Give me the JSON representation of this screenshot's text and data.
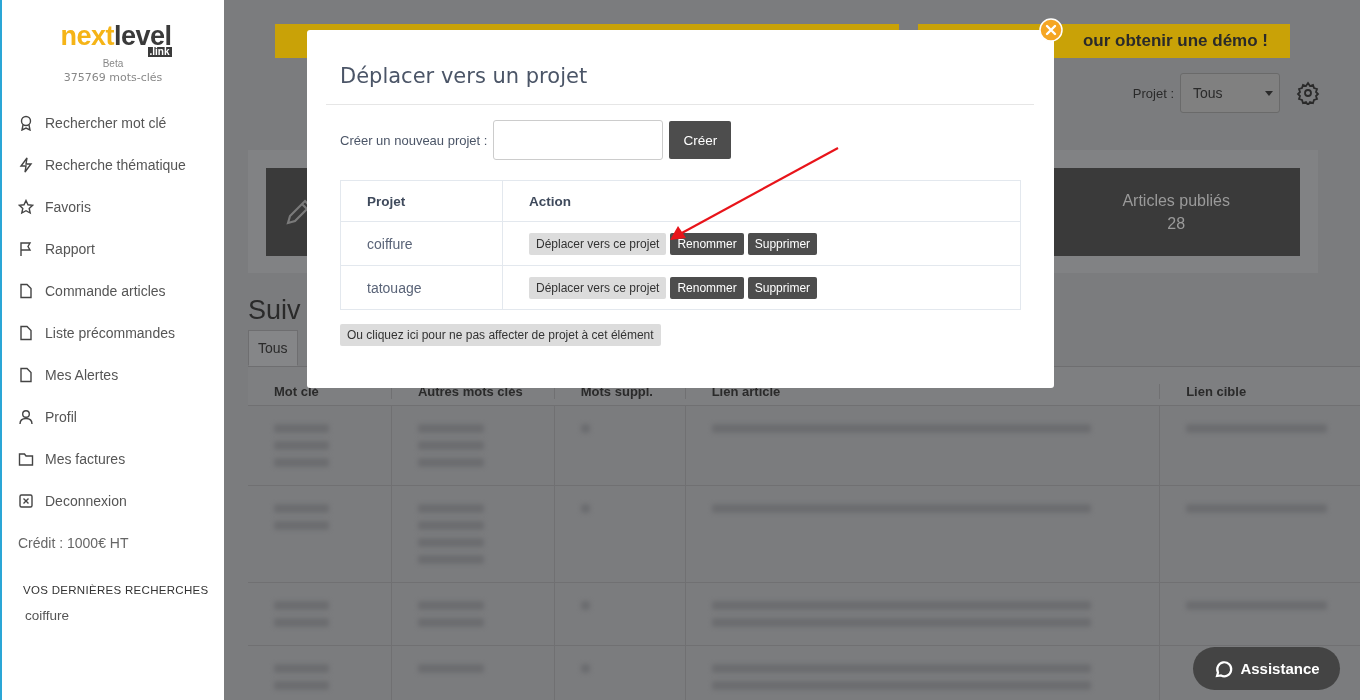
{
  "sidebar": {
    "logo": {
      "part_1": "next",
      "part_2": "level",
      "suffix": ".link"
    },
    "beta": "Beta",
    "keyword_count": "375769 mots-clés",
    "items": [
      {
        "label": "Rechercher mot clé"
      },
      {
        "label": "Recherche thématique"
      },
      {
        "label": "Favoris"
      },
      {
        "label": "Rapport"
      },
      {
        "label": "Commande articles"
      },
      {
        "label": "Liste précommandes"
      },
      {
        "label": "Mes Alertes"
      },
      {
        "label": "Profil"
      },
      {
        "label": "Mes factures"
      },
      {
        "label": "Deconnexion"
      }
    ],
    "credit": "Crédit : 1000€ HT",
    "recent_heading": "VOS DERNIÈRES RECHERCHES",
    "recent": [
      "coiffure"
    ]
  },
  "background": {
    "banner_right": "our obtenir une démo !",
    "project_label": "Projet :",
    "project_select": "Tous",
    "stat_label": "Articles publiés",
    "stat_value": "28",
    "heading": "Suiv",
    "tabs": [
      {
        "label": "Tous",
        "selected": true
      }
    ],
    "table": {
      "columns": [
        "Mot clé",
        "Autres mots clés",
        "Mots suppl.",
        "Lien article",
        "Lien cible"
      ]
    }
  },
  "modal": {
    "title": "Déplacer vers un projet",
    "create_label": "Créer un nouveau projet :",
    "create_button": "Créer",
    "columns": [
      "Projet",
      "Action"
    ],
    "rows": [
      {
        "name": "coiffure",
        "actions": [
          "Déplacer vers ce projet",
          "Renommer",
          "Supprimer"
        ]
      },
      {
        "name": "tatouage",
        "actions": [
          "Déplacer vers ce projet",
          "Renommer",
          "Supprimer"
        ]
      }
    ],
    "no_project_button": "Ou cliquez ici pour ne pas affecter de projet à cet élément"
  },
  "assistance": "Assistance"
}
